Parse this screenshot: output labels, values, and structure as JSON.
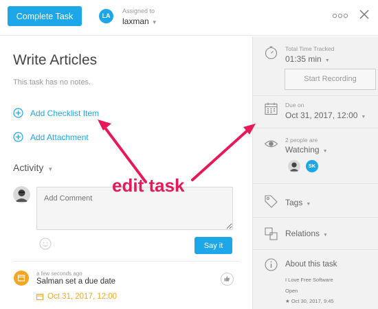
{
  "header": {
    "complete_label": "Complete Task",
    "avatar_initials": "LA",
    "assigned_label": "Assigned to",
    "assignee": "laxman"
  },
  "task": {
    "title": "Write Articles",
    "notes": "This task has no notes.",
    "add_checklist": "Add Checklist Item",
    "add_attachment": "Add Attachment"
  },
  "activity": {
    "heading": "Activity",
    "comment_placeholder": "Add Comment",
    "say_it_label": "Say it",
    "entry_time": "a few seconds ago",
    "entry_text": "Salman set a due date",
    "entry_date": "Oct 31, 2017, 12:00"
  },
  "sidebar": {
    "time_label": "Total Time Tracked",
    "time_value": "01:35 min",
    "record_label": "Start Recording",
    "due_label": "Due on",
    "due_value": "Oct 31, 2017, 12:00",
    "watchers_label": "2 people are",
    "watching_value": "Watching",
    "watcher_initials": "SK",
    "tags_label": "Tags",
    "relations_label": "Relations",
    "about_label": "About this task",
    "about_project": "I Love Free Software",
    "about_status": "Open",
    "about_created": "Oct 30, 2017, 9:45"
  },
  "annotation": {
    "text": "edit task"
  },
  "colors": {
    "accent": "#1ea7e8",
    "annotation": "#e8195a",
    "activity": "#f5a623"
  }
}
